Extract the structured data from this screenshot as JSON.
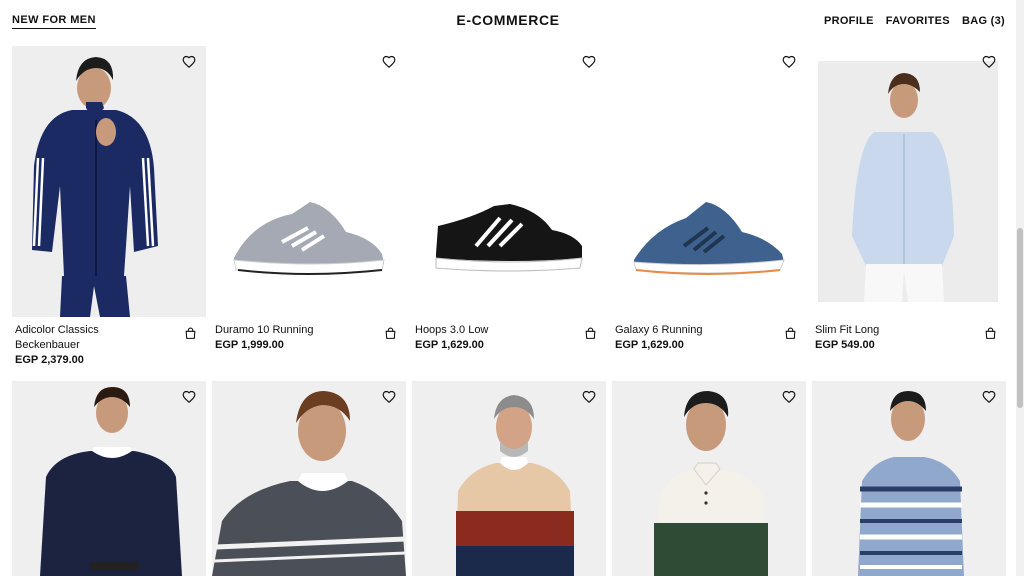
{
  "header": {
    "left_link": "NEW FOR MEN",
    "brand": "E-COMMERCE",
    "right_links": [
      "PROFILE",
      "FAVORITES",
      "BAG (3)"
    ]
  },
  "products": [
    {
      "name_line1": "Adicolor Classics",
      "name_line2": "Beckenbauer",
      "price": "EGP 2,379.00",
      "image": "man-navy-track-jacket"
    },
    {
      "name_line1": "Duramo 10 Running",
      "name_line2": "",
      "price": "EGP 1,999.00",
      "image": "grey-running-shoe"
    },
    {
      "name_line1": "Hoops 3.0 Low",
      "name_line2": "",
      "price": "EGP 1,629.00",
      "image": "black-low-sneaker"
    },
    {
      "name_line1": "Galaxy 6 Running",
      "name_line2": "",
      "price": "EGP 1,629.00",
      "image": "blue-running-shoe"
    },
    {
      "name_line1": "Slim Fit Long",
      "name_line2": "",
      "price": "EGP 549.00",
      "image": "man-light-blue-shirt"
    },
    {
      "image": "man-navy-sweater"
    },
    {
      "image": "man-grey-striped-sweater"
    },
    {
      "image": "man-colorblock-sweater"
    },
    {
      "image": "man-green-white-polo"
    },
    {
      "image": "man-blue-striped-sweater"
    }
  ],
  "colors": {
    "text": "#111111",
    "image_bg": "#f4f4f4",
    "accent": "#111111"
  }
}
